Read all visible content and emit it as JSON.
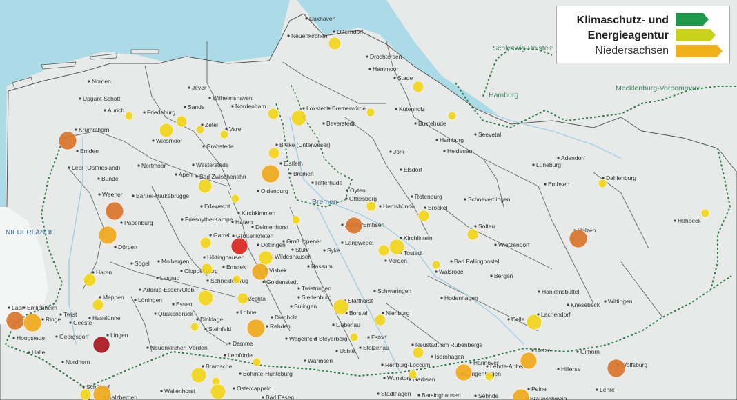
{
  "legend": {
    "line1": "Klimaschutz- und",
    "line2": "Energieagentur",
    "line3": "Niedersachsen",
    "arrow_colors": [
      "#1f9a4a",
      "#c8d21a",
      "#f1b11a"
    ]
  },
  "colors": {
    "water": "#aadbe6",
    "land": "#e8eaea",
    "border": "#555555",
    "state_border": "#2e7d45",
    "marker_yellow": "#f2d51a",
    "marker_amber": "#efa91c",
    "marker_orange": "#d9742a",
    "marker_red": "#d9261c",
    "marker_dark_red": "#a8171c"
  },
  "labels": {
    "niederlande": "NIEDERLANDE",
    "schleswig_holstein": "Schleswig-Holstein",
    "hamburg": "Hamburg",
    "mecklenburg": "Mecklenburg-Vorpommern",
    "bremen": "Bremen"
  },
  "places": [
    "Cuxhaven",
    "Neuenkirchen",
    "Otterndorf",
    "Drochtersen",
    "Hemmoor",
    "Stade",
    "Norden",
    "Upgant-Schott",
    "Aurich",
    "Jever",
    "Sande",
    "Wilhelmshaven",
    "Nordenham",
    "Friedeburg",
    "Krummhörn",
    "Emden",
    "Zetel",
    "Varel",
    "Wiesmoor",
    "Grabstede",
    "Loxstedt",
    "Bremervörde",
    "Beverstedt",
    "Kutenholz",
    "Buxtehude",
    "Leer (Ostfriesland)",
    "Nortmoor",
    "Westerstede",
    "Brake (Unterweser)",
    "Elsfleth",
    "Bunde",
    "Apen",
    "Bad Zwischenahn",
    "Bremen",
    "Ritterhude",
    "Weener",
    "Barßel-Harkebrügge",
    "Edewecht",
    "Oldenburg",
    "Kirchkimmen",
    "Hatten",
    "Delmenhorst",
    "Papenburg",
    "Friesoythe-Kampe",
    "Garrel",
    "Großenkneten",
    "Dötlingen",
    "Dörpen",
    "Höltinghausen",
    "Wildeshausen",
    "Stuhr",
    "Groß Ippener",
    "Syke",
    "Bassum",
    "Sögel",
    "Molbergen",
    "Cloppenburg",
    "Emstek",
    "Visbek",
    "Haren",
    "Lastrup",
    "Schneiderkrug",
    "Goldenstedt",
    "Addrup-Essen/Oldb.",
    "Meppen",
    "Löningen",
    "Essen",
    "Vechta",
    "Quakenbrück",
    "Lohne",
    "Dinklage",
    "Steinfeld",
    "Diepholz",
    "Rehden",
    "Laar",
    "Emlichheim",
    "Twist",
    "Ringe",
    "Geeste",
    "Haselünne",
    "Hoogstede",
    "Georgsdorf",
    "Lingen",
    "Halle",
    "Nordhorn",
    "Neuenkirchen-Vörden",
    "Damme",
    "Bramsche",
    "Lemförde",
    "Bohmte-Hunteburg",
    "Schüttorf",
    "Salzbergen",
    "Wallenhorst",
    "Ostercappeln",
    "Bad Essen",
    "Twistringen",
    "Siedenburg",
    "Sulingen",
    "Staffhorst",
    "Liebenau",
    "Borstel",
    "Wagenfeld",
    "Steyerberg",
    "Uchte",
    "Nienburg",
    "Estorf",
    "Stolzenau",
    "Warmsen",
    "Rehburg-Loccum",
    "Wunstorf",
    "Garbsen",
    "Stadthagen",
    "Barsinghausen",
    "Oyten",
    "Ottersberg",
    "Achim/Embsen",
    "Langwedel",
    "Hemsbünde",
    "Kirchlinteln",
    "Verden",
    "Rotenburg",
    "Brockel",
    "Schneverdingen",
    "Soltau",
    "Wietzendorf",
    "Bad Fallingbostel",
    "Walsrode",
    "Bergen",
    "Schwaringen",
    "Hodenhagen",
    "Celle",
    "Lachendorf",
    "Neustadt am Rübenberge",
    "Isernhagen",
    "Hannover",
    "Langenhagen",
    "Lehrte-Ahlten",
    "Sehnde",
    "Peine",
    "Braunschweig",
    "Uetze",
    "Hillerse",
    "Gifhorn",
    "Wolfsburg",
    "Lehre",
    "Hamburg",
    "Heidenau",
    "Seevetal",
    "Elsdorf",
    "Jork",
    "Adendorf",
    "Lüneburg",
    "Embsen",
    "Dahlenburg",
    "Uelzen",
    "Höhbeck",
    "Hankensbüttel",
    "Knesebeck",
    "Wittingen",
    "Tostedt"
  ]
}
